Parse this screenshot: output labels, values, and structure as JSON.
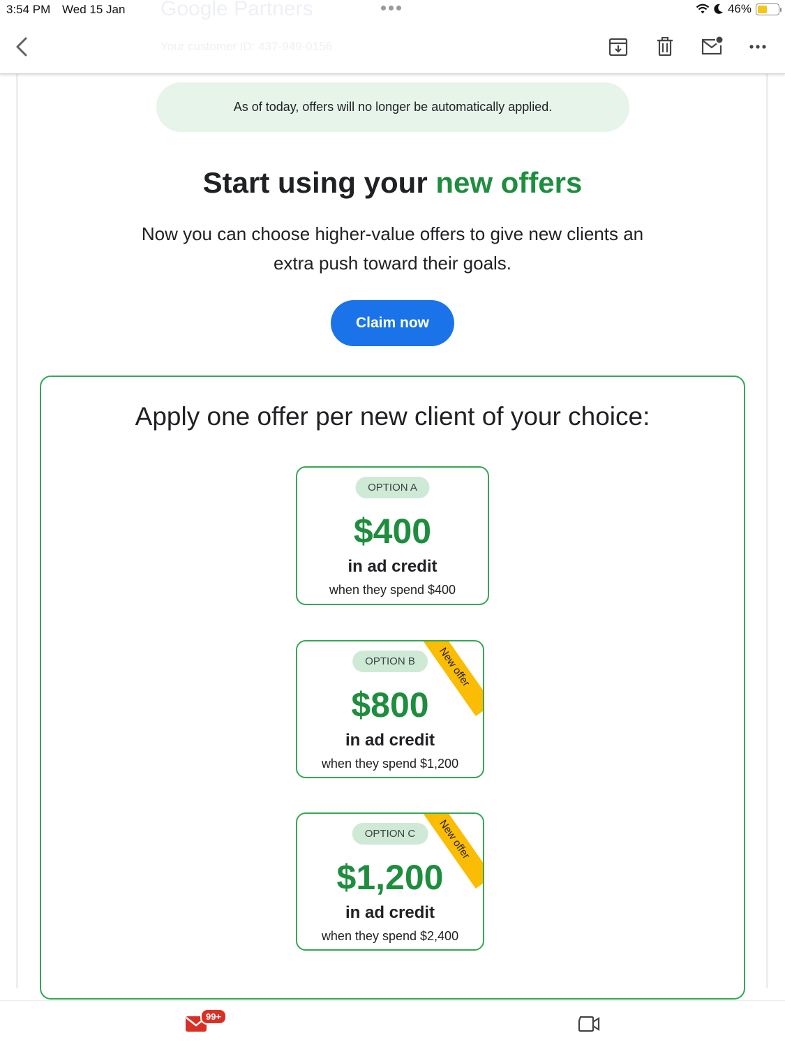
{
  "status_bar": {
    "time": "3:54 PM",
    "date": "Wed 15 Jan",
    "battery": "46%",
    "battery_level": 0.46
  },
  "toolbar": {
    "ghost_title": "Google Partners",
    "ghost_subtitle": "Your customer ID: 437-949-0156",
    "icons": [
      "back-icon",
      "archive-icon",
      "delete-icon",
      "mark-unread-icon",
      "more-icon"
    ]
  },
  "email": {
    "notice": "As of today, offers will no longer be automatically applied.",
    "headline_prefix": "Start using your ",
    "headline_accent": "new offers",
    "subline": "Now you can choose higher-value offers to give new clients an extra push toward their goals.",
    "cta_label": "Claim now",
    "offers_title": "Apply one offer per new client of your choice:",
    "offers": [
      {
        "option": "OPTION A",
        "amount": "$400",
        "credit": "in ad credit",
        "spend": "when they spend $400",
        "ribbon": ""
      },
      {
        "option": "OPTION B",
        "amount": "$800",
        "credit": "in ad credit",
        "spend": "when they spend $1,200",
        "ribbon": "New offer"
      },
      {
        "option": "OPTION C",
        "amount": "$1,200",
        "credit": "in ad credit",
        "spend": "when they spend $2,400",
        "ribbon": "New offer"
      }
    ]
  },
  "bottom_bar": {
    "mail_badge": "99+"
  },
  "colors": {
    "accent_green": "#1e8e3e",
    "cta_blue": "#1a73e8",
    "ribbon_yellow": "#fbbc04",
    "badge_red": "#d93025"
  }
}
